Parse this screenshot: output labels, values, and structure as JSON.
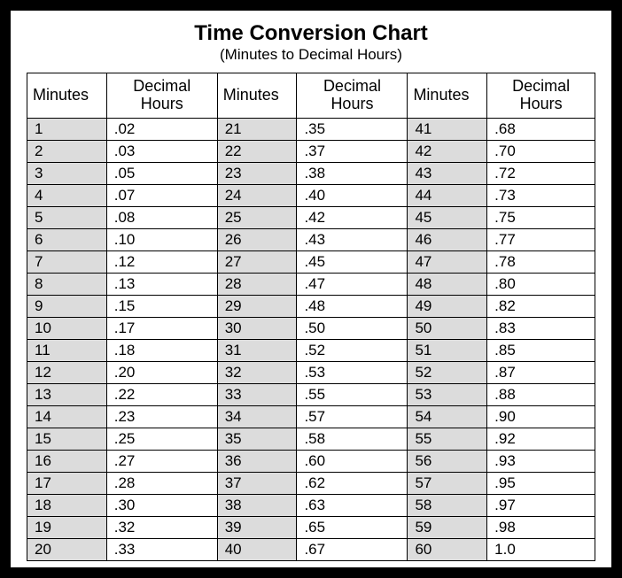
{
  "title": "Time Conversion Chart",
  "subtitle": "(Minutes to Decimal Hours)",
  "headers": {
    "minutes": "Minutes",
    "decimal": "Decimal Hours"
  },
  "chart_data": {
    "type": "table",
    "title": "Time Conversion Chart (Minutes to Decimal Hours)",
    "columns": [
      "Minutes",
      "Decimal Hours"
    ],
    "rows": [
      [
        1,
        ".02"
      ],
      [
        2,
        ".03"
      ],
      [
        3,
        ".05"
      ],
      [
        4,
        ".07"
      ],
      [
        5,
        ".08"
      ],
      [
        6,
        ".10"
      ],
      [
        7,
        ".12"
      ],
      [
        8,
        ".13"
      ],
      [
        9,
        ".15"
      ],
      [
        10,
        ".17"
      ],
      [
        11,
        ".18"
      ],
      [
        12,
        ".20"
      ],
      [
        13,
        ".22"
      ],
      [
        14,
        ".23"
      ],
      [
        15,
        ".25"
      ],
      [
        16,
        ".27"
      ],
      [
        17,
        ".28"
      ],
      [
        18,
        ".30"
      ],
      [
        19,
        ".32"
      ],
      [
        20,
        ".33"
      ],
      [
        21,
        ".35"
      ],
      [
        22,
        ".37"
      ],
      [
        23,
        ".38"
      ],
      [
        24,
        ".40"
      ],
      [
        25,
        ".42"
      ],
      [
        26,
        ".43"
      ],
      [
        27,
        ".45"
      ],
      [
        28,
        ".47"
      ],
      [
        29,
        ".48"
      ],
      [
        30,
        ".50"
      ],
      [
        31,
        ".52"
      ],
      [
        32,
        ".53"
      ],
      [
        33,
        ".55"
      ],
      [
        34,
        ".57"
      ],
      [
        35,
        ".58"
      ],
      [
        36,
        ".60"
      ],
      [
        37,
        ".62"
      ],
      [
        38,
        ".63"
      ],
      [
        39,
        ".65"
      ],
      [
        40,
        ".67"
      ],
      [
        41,
        ".68"
      ],
      [
        42,
        ".70"
      ],
      [
        43,
        ".72"
      ],
      [
        44,
        ".73"
      ],
      [
        45,
        ".75"
      ],
      [
        46,
        ".77"
      ],
      [
        47,
        ".78"
      ],
      [
        48,
        ".80"
      ],
      [
        49,
        ".82"
      ],
      [
        50,
        ".83"
      ],
      [
        51,
        ".85"
      ],
      [
        52,
        ".87"
      ],
      [
        53,
        ".88"
      ],
      [
        54,
        ".90"
      ],
      [
        55,
        ".92"
      ],
      [
        56,
        ".93"
      ],
      [
        57,
        ".95"
      ],
      [
        58,
        ".97"
      ],
      [
        59,
        ".98"
      ],
      [
        60,
        "1.0"
      ]
    ]
  }
}
